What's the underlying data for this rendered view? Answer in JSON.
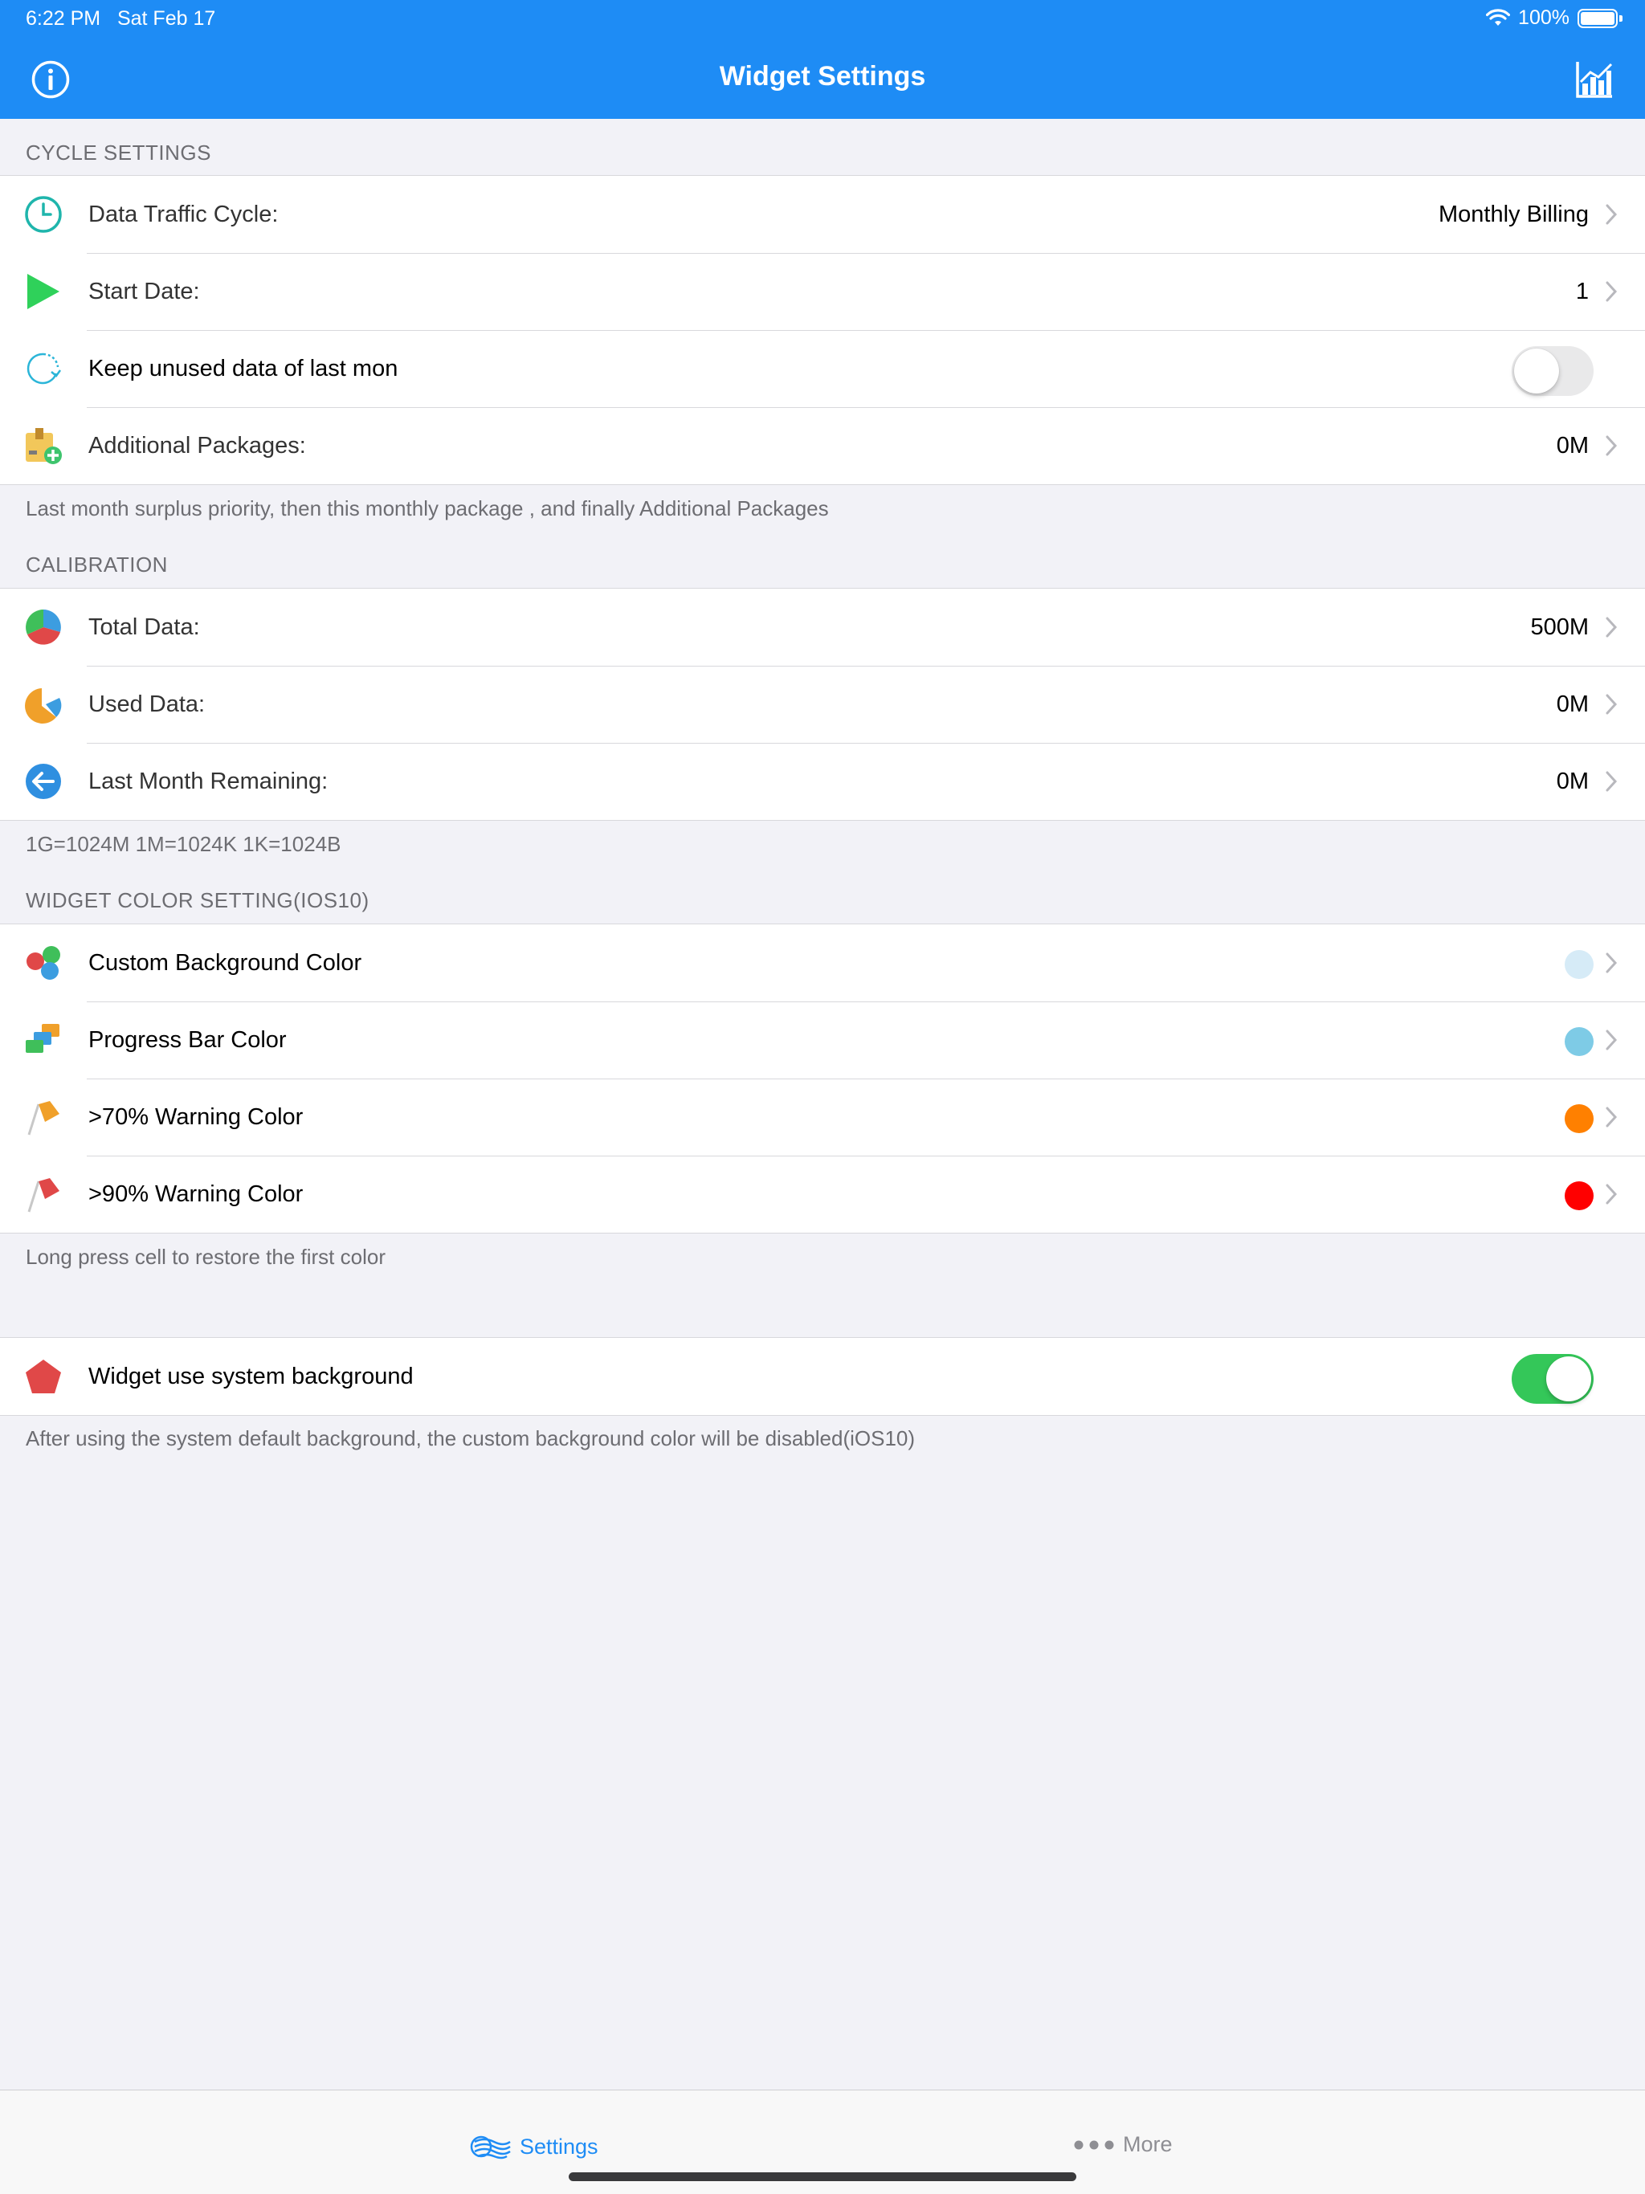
{
  "status_bar": {
    "time": "6:22 PM",
    "date": "Sat Feb 17",
    "battery": "100%"
  },
  "nav": {
    "title": "Widget Settings"
  },
  "sections": {
    "cycle": {
      "header": "CYCLE SETTINGS",
      "rows": [
        {
          "label": "Data Traffic Cycle:",
          "value": "Monthly Billing",
          "icon": "clock-icon"
        },
        {
          "label": "Start Date:",
          "value": "1",
          "icon": "play-icon"
        },
        {
          "label": "Keep unused data of last mon",
          "toggle": false,
          "icon": "refresh-icon"
        },
        {
          "label": "Additional Packages:",
          "value": "0M",
          "icon": "package-add-icon"
        }
      ],
      "footer": "Last month surplus priority, then this monthly package , and finally Additional Packages"
    },
    "calibration": {
      "header": "CALIBRATION",
      "rows": [
        {
          "label": "Total Data:",
          "value": "500M",
          "icon": "pie-chart-icon"
        },
        {
          "label": "Used Data:",
          "value": "0M",
          "icon": "pie-slice-icon"
        },
        {
          "label": "Last Month Remaining:",
          "value": "0M",
          "icon": "back-arrow-icon"
        }
      ],
      "footer": "1G=1024M  1M=1024K  1K=1024B"
    },
    "color": {
      "header": "WIDGET COLOR SETTING(IOS10)",
      "rows": [
        {
          "label": "Custom Background Color",
          "color": "#d6ebf7",
          "icon": "color-circles-icon"
        },
        {
          "label": "Progress Bar Color",
          "color": "#7ecbe6",
          "icon": "color-blocks-icon"
        },
        {
          "label": ">70% Warning Color",
          "color": "#ff8000",
          "icon": "orange-flag-icon"
        },
        {
          "label": ">90% Warning Color",
          "color": "#ff0000",
          "icon": "red-flag-icon"
        }
      ],
      "footer": "Long press cell to restore the first color"
    },
    "system": {
      "rows": [
        {
          "label": "Widget use system background",
          "toggle": true,
          "icon": "pentagon-icon"
        }
      ],
      "footer": "After using the system default background, the custom background color will be disabled(iOS10)"
    }
  },
  "tabbar": {
    "settings": "Settings",
    "more": "More"
  },
  "colors": {
    "accent": "#1e8cf5",
    "switch_on": "#34c759"
  }
}
